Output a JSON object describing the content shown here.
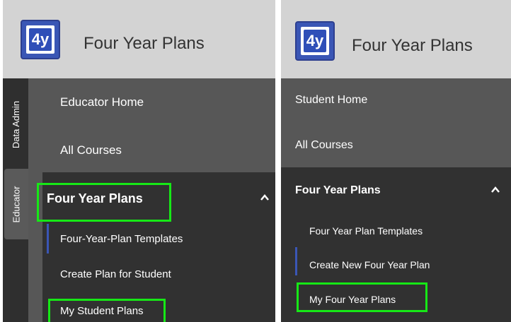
{
  "left": {
    "logo_text": "4y",
    "title": "Four Year Plans",
    "rail_tabs": [
      {
        "label": "Data Admin"
      },
      {
        "label": "Educator"
      }
    ],
    "nav": {
      "educator_home": "Educator Home",
      "all_courses": "All Courses",
      "section_label": "Four Year Plans",
      "subitems": [
        {
          "label": "Four-Year-Plan Templates"
        },
        {
          "label": "Create Plan for Student"
        },
        {
          "label": "My Student Plans"
        }
      ]
    }
  },
  "right": {
    "logo_text": "4y",
    "title": "Four Year Plans",
    "nav": {
      "student_home": "Student Home",
      "all_courses": "All Courses",
      "section_label": "Four Year Plans",
      "subitems": [
        {
          "label": "Four Year Plan Templates"
        },
        {
          "label": "Create New Four Year Plan"
        },
        {
          "label": "My Four Year Plans"
        }
      ]
    }
  },
  "colors": {
    "brand_blue": "#2f4fb8",
    "highlight_green": "#16e816",
    "nav_gray": "#575757",
    "submenu_dark": "#313131",
    "header_gray": "#d3d3d3"
  }
}
